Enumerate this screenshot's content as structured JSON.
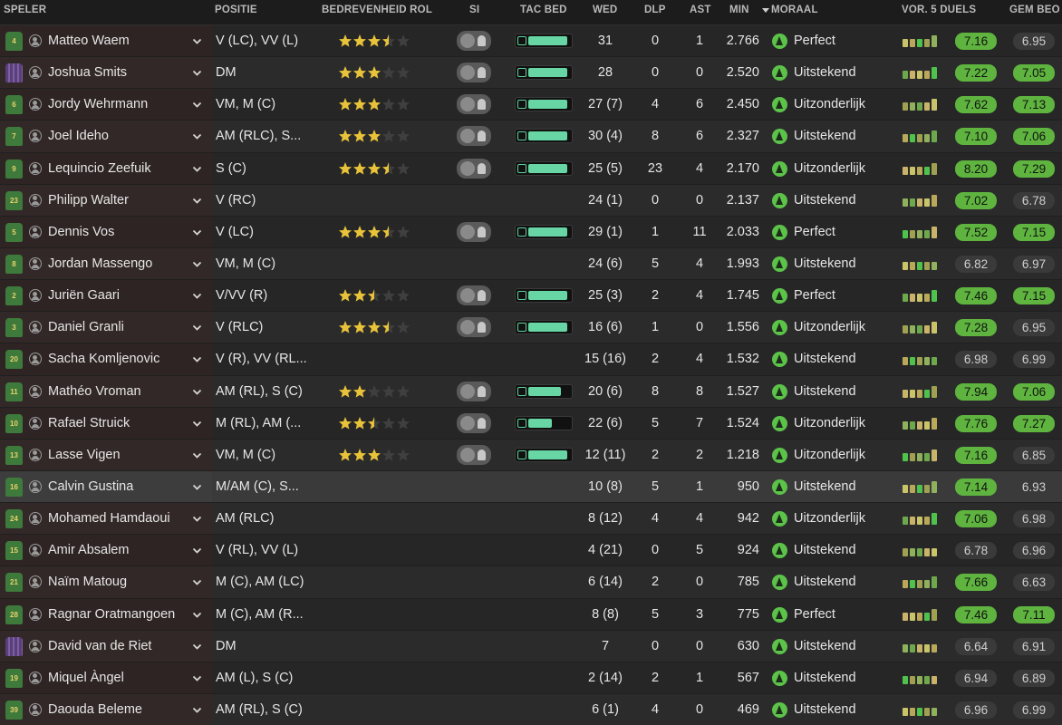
{
  "header": {
    "speler": "SPELER",
    "positie": "POSITIE",
    "rol": "BEDREVENHEID ROL",
    "si": "SI",
    "tac": "TAC BED",
    "wed": "WED",
    "dlp": "DLP",
    "ast": "AST",
    "min": "MIN",
    "moraal": "MORAAL",
    "form": "VOR. 5 DUELS",
    "gem": "GEM BEO"
  },
  "colors": {
    "good": "#5eb43f",
    "tac_bar": "#67d6a4",
    "star": "#e8c33a"
  },
  "players": [
    {
      "shirt": "4",
      "gk": false,
      "name": "Matteo Waem",
      "pos": "V (LC), VV (L)",
      "stars": 3.5,
      "si": true,
      "tac": 0.9,
      "wed": "31",
      "dlp": "0",
      "ast": "1",
      "min": "2.766",
      "moraal": "Perfect",
      "form": "7.16",
      "form_hi": true,
      "gem": "6.95",
      "gem_hi": false
    },
    {
      "shirt": "",
      "gk": true,
      "name": "Joshua Smits",
      "pos": "DM",
      "stars": 3,
      "si": true,
      "tac": 0.9,
      "wed": "28",
      "dlp": "0",
      "ast": "0",
      "min": "2.520",
      "moraal": "Uitstekend",
      "form": "7.22",
      "form_hi": true,
      "gem": "7.05",
      "gem_hi": true
    },
    {
      "shirt": "6",
      "gk": false,
      "name": "Jordy Wehrmann",
      "pos": "VM, M (C)",
      "stars": 3,
      "si": true,
      "tac": 0.9,
      "wed": "27 (7)",
      "dlp": "4",
      "ast": "6",
      "min": "2.450",
      "moraal": "Uitzonderlijk",
      "form": "7.62",
      "form_hi": true,
      "gem": "7.13",
      "gem_hi": true
    },
    {
      "shirt": "7",
      "gk": false,
      "name": "Joel Ideho",
      "pos": "AM (RLC), S...",
      "stars": 3,
      "si": true,
      "tac": 0.9,
      "wed": "30 (4)",
      "dlp": "8",
      "ast": "6",
      "min": "2.327",
      "moraal": "Uitstekend",
      "form": "7.10",
      "form_hi": true,
      "gem": "7.06",
      "gem_hi": true
    },
    {
      "shirt": "9",
      "gk": false,
      "name": "Lequincio Zeefuik",
      "pos": "S (C)",
      "stars": 3.5,
      "si": true,
      "tac": 0.9,
      "wed": "25 (5)",
      "dlp": "23",
      "ast": "4",
      "min": "2.170",
      "moraal": "Uitzonderlijk",
      "form": "8.20",
      "form_hi": true,
      "gem": "7.29",
      "gem_hi": true
    },
    {
      "shirt": "23",
      "gk": false,
      "name": "Philipp Walter",
      "pos": "V (RC)",
      "stars": 0,
      "si": false,
      "tac": 0,
      "wed": "24 (1)",
      "dlp": "0",
      "ast": "0",
      "min": "2.137",
      "moraal": "Uitstekend",
      "form": "7.02",
      "form_hi": true,
      "gem": "6.78",
      "gem_hi": false
    },
    {
      "shirt": "5",
      "gk": false,
      "name": "Dennis Vos",
      "pos": "V (LC)",
      "stars": 3.5,
      "si": true,
      "tac": 0.9,
      "wed": "29 (1)",
      "dlp": "1",
      "ast": "11",
      "min": "2.033",
      "moraal": "Perfect",
      "form": "7.52",
      "form_hi": true,
      "gem": "7.15",
      "gem_hi": true
    },
    {
      "shirt": "8",
      "gk": false,
      "name": "Jordan Massengo",
      "pos": "VM, M (C)",
      "stars": 0,
      "si": false,
      "tac": 0,
      "wed": "24 (6)",
      "dlp": "5",
      "ast": "4",
      "min": "1.993",
      "moraal": "Uitstekend",
      "form": "6.82",
      "form_hi": false,
      "gem": "6.97",
      "gem_hi": false
    },
    {
      "shirt": "2",
      "gk": false,
      "name": "Juriën Gaari",
      "pos": "V/VV (R)",
      "stars": 2.5,
      "si": true,
      "tac": 0.9,
      "wed": "25 (3)",
      "dlp": "2",
      "ast": "4",
      "min": "1.745",
      "moraal": "Perfect",
      "form": "7.46",
      "form_hi": true,
      "gem": "7.15",
      "gem_hi": true
    },
    {
      "shirt": "3",
      "gk": false,
      "name": "Daniel Granli",
      "pos": "V (RLC)",
      "stars": 3.5,
      "si": true,
      "tac": 0.9,
      "wed": "16 (6)",
      "dlp": "1",
      "ast": "0",
      "min": "1.556",
      "moraal": "Uitzonderlijk",
      "form": "7.28",
      "form_hi": true,
      "gem": "6.95",
      "gem_hi": false
    },
    {
      "shirt": "20",
      "gk": false,
      "name": "Sacha Komljenovic",
      "pos": "V (R), VV (RL...",
      "stars": 0,
      "si": false,
      "tac": 0,
      "wed": "15 (16)",
      "dlp": "2",
      "ast": "4",
      "min": "1.532",
      "moraal": "Uitstekend",
      "form": "6.98",
      "form_hi": false,
      "gem": "6.99",
      "gem_hi": false
    },
    {
      "shirt": "11",
      "gk": false,
      "name": "Mathéo Vroman",
      "pos": "AM (RL), S (C)",
      "stars": 2,
      "si": true,
      "tac": 0.75,
      "wed": "20 (6)",
      "dlp": "8",
      "ast": "8",
      "min": "1.527",
      "moraal": "Uitstekend",
      "form": "7.94",
      "form_hi": true,
      "gem": "7.06",
      "gem_hi": true
    },
    {
      "shirt": "10",
      "gk": false,
      "name": "Rafael Struick",
      "pos": "M (RL), AM (...",
      "stars": 2.5,
      "si": true,
      "tac": 0.55,
      "wed": "22 (6)",
      "dlp": "5",
      "ast": "7",
      "min": "1.524",
      "moraal": "Uitzonderlijk",
      "form": "7.76",
      "form_hi": true,
      "gem": "7.27",
      "gem_hi": true
    },
    {
      "shirt": "13",
      "gk": false,
      "name": "Lasse Vigen",
      "pos": "VM, M (C)",
      "stars": 3,
      "si": true,
      "tac": 0.9,
      "wed": "12 (11)",
      "dlp": "2",
      "ast": "2",
      "min": "1.218",
      "moraal": "Uitzonderlijk",
      "form": "7.16",
      "form_hi": true,
      "gem": "6.85",
      "gem_hi": false
    },
    {
      "shirt": "16",
      "gk": false,
      "name": "Calvin Gustina",
      "pos": "M/AM (C), S...",
      "stars": 0,
      "si": false,
      "tac": 0,
      "wed": "10 (8)",
      "dlp": "5",
      "ast": "1",
      "min": "950",
      "moraal": "Uitstekend",
      "form": "7.14",
      "form_hi": true,
      "gem": "6.93",
      "gem_hi": false,
      "selected": true
    },
    {
      "shirt": "24",
      "gk": false,
      "name": "Mohamed Hamdaoui",
      "pos": "AM (RLC)",
      "stars": 0,
      "si": false,
      "tac": 0,
      "wed": "8 (12)",
      "dlp": "4",
      "ast": "4",
      "min": "942",
      "moraal": "Uitzonderlijk",
      "form": "7.06",
      "form_hi": true,
      "gem": "6.98",
      "gem_hi": false
    },
    {
      "shirt": "15",
      "gk": false,
      "name": "Amir Absalem",
      "pos": "V (RL), VV (L)",
      "stars": 0,
      "si": false,
      "tac": 0,
      "wed": "4 (21)",
      "dlp": "0",
      "ast": "5",
      "min": "924",
      "moraal": "Uitstekend",
      "form": "6.78",
      "form_hi": false,
      "gem": "6.96",
      "gem_hi": false
    },
    {
      "shirt": "21",
      "gk": false,
      "name": "Naïm Matoug",
      "pos": "M (C), AM (LC)",
      "stars": 0,
      "si": false,
      "tac": 0,
      "wed": "6 (14)",
      "dlp": "2",
      "ast": "0",
      "min": "785",
      "moraal": "Uitstekend",
      "form": "7.66",
      "form_hi": true,
      "gem": "6.63",
      "gem_hi": false
    },
    {
      "shirt": "28",
      "gk": false,
      "name": "Ragnar Oratmangoen",
      "pos": "M (C), AM (R...",
      "stars": 0,
      "si": false,
      "tac": 0,
      "wed": "8 (8)",
      "dlp": "5",
      "ast": "3",
      "min": "775",
      "moraal": "Perfect",
      "form": "7.46",
      "form_hi": true,
      "gem": "7.11",
      "gem_hi": true
    },
    {
      "shirt": "",
      "gk": true,
      "name": "David van de Riet",
      "pos": "DM",
      "stars": 0,
      "si": false,
      "tac": 0,
      "wed": "7",
      "dlp": "0",
      "ast": "0",
      "min": "630",
      "moraal": "Uitstekend",
      "form": "6.64",
      "form_hi": false,
      "gem": "6.91",
      "gem_hi": false
    },
    {
      "shirt": "19",
      "gk": false,
      "name": "Miquel Àngel",
      "pos": "AM (L), S (C)",
      "stars": 0,
      "si": false,
      "tac": 0,
      "wed": "2 (14)",
      "dlp": "2",
      "ast": "1",
      "min": "567",
      "moraal": "Uitstekend",
      "form": "6.94",
      "form_hi": false,
      "gem": "6.89",
      "gem_hi": false
    },
    {
      "shirt": "39",
      "gk": false,
      "name": "Daouda Beleme",
      "pos": "AM (RL), S (C)",
      "stars": 0,
      "si": false,
      "tac": 0,
      "wed": "6 (1)",
      "dlp": "4",
      "ast": "0",
      "min": "469",
      "moraal": "Uitstekend",
      "form": "6.96",
      "form_hi": false,
      "gem": "6.99",
      "gem_hi": false
    }
  ]
}
